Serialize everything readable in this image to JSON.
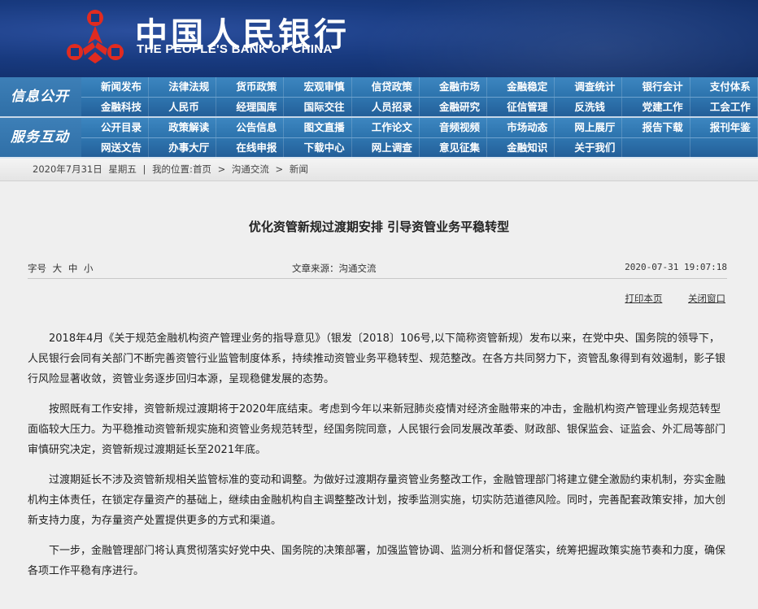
{
  "header": {
    "bank_name_cn": "中国人民银行",
    "bank_name_en": "THE PEOPLE'S BANK OF CHINA",
    "logo_icon": "pboc-logo-icon",
    "colors": {
      "banner": "#183a7f",
      "nav": "#2c73ad",
      "logo": "#e02b20"
    }
  },
  "nav": {
    "band1_label": "信息公开",
    "band1_rows": [
      [
        "新闻发布",
        "法律法规",
        "货币政策",
        "宏观审慎",
        "信贷政策",
        "金融市场",
        "金融稳定",
        "调查统计",
        "银行会计",
        "支付体系"
      ],
      [
        "金融科技",
        "人民币",
        "经理国库",
        "国际交往",
        "人员招录",
        "金融研究",
        "征信管理",
        "反洗钱",
        "党建工作",
        "工会工作"
      ]
    ],
    "band2_label": "服务互动",
    "band2_rows": [
      [
        "公开目录",
        "政策解读",
        "公告信息",
        "图文直播",
        "工作论文",
        "音频视频",
        "市场动态",
        "网上展厅",
        "报告下载",
        "报刊年鉴"
      ],
      [
        "网送文告",
        "办事大厅",
        "在线申报",
        "下载中心",
        "网上调查",
        "意见征集",
        "金融知识",
        "关于我们",
        "",
        ""
      ]
    ]
  },
  "breadcrumb": {
    "date": "2020年7月31日",
    "weekday": "星期五",
    "separator": "|",
    "prefix": "我的位置:",
    "path": [
      "首页",
      "沟通交流",
      "新闻"
    ],
    "path_sep": ">"
  },
  "article": {
    "title": "优化资管新规过渡期安排  引导资管业务平稳转型",
    "font_label": "字号",
    "font_sizes": [
      "大",
      "中",
      "小"
    ],
    "source": "文章来源：沟通交流",
    "datetime": "2020-07-31 19:07:18",
    "print_label": "打印本页",
    "close_label": "关闭窗口",
    "paragraphs": [
      "2018年4月《关于规范金融机构资产管理业务的指导意见》（银发〔2018〕106号,以下简称资管新规）发布以来，在党中央、国务院的领导下，人民银行会同有关部门不断完善资管行业监管制度体系，持续推动资管业务平稳转型、规范整改。在各方共同努力下，资管乱象得到有效遏制，影子银行风险显著收敛，资管业务逐步回归本源，呈现稳健发展的态势。",
      "按照既有工作安排，资管新规过渡期将于2020年底结束。考虑到今年以来新冠肺炎疫情对经济金融带来的冲击，金融机构资产管理业务规范转型面临较大压力。为平稳推动资管新规实施和资管业务规范转型，经国务院同意，人民银行会同发展改革委、财政部、银保监会、证监会、外汇局等部门审慎研究决定，资管新规过渡期延长至2021年底。",
      "过渡期延长不涉及资管新规相关监管标准的变动和调整。为做好过渡期存量资管业务整改工作，金融管理部门将建立健全激励约束机制，夯实金融机构主体责任，在锁定存量资产的基础上，继续由金融机构自主调整整改计划，按季监测实施，切实防范道德风险。同时，完善配套政策安排，加大创新支持力度，为存量资产处置提供更多的方式和渠道。",
      "下一步，金融管理部门将认真贯彻落实好党中央、国务院的决策部署，加强监管协调、监测分析和督促落实，统筹把握政策实施节奏和力度，确保各项工作平稳有序进行。"
    ]
  }
}
